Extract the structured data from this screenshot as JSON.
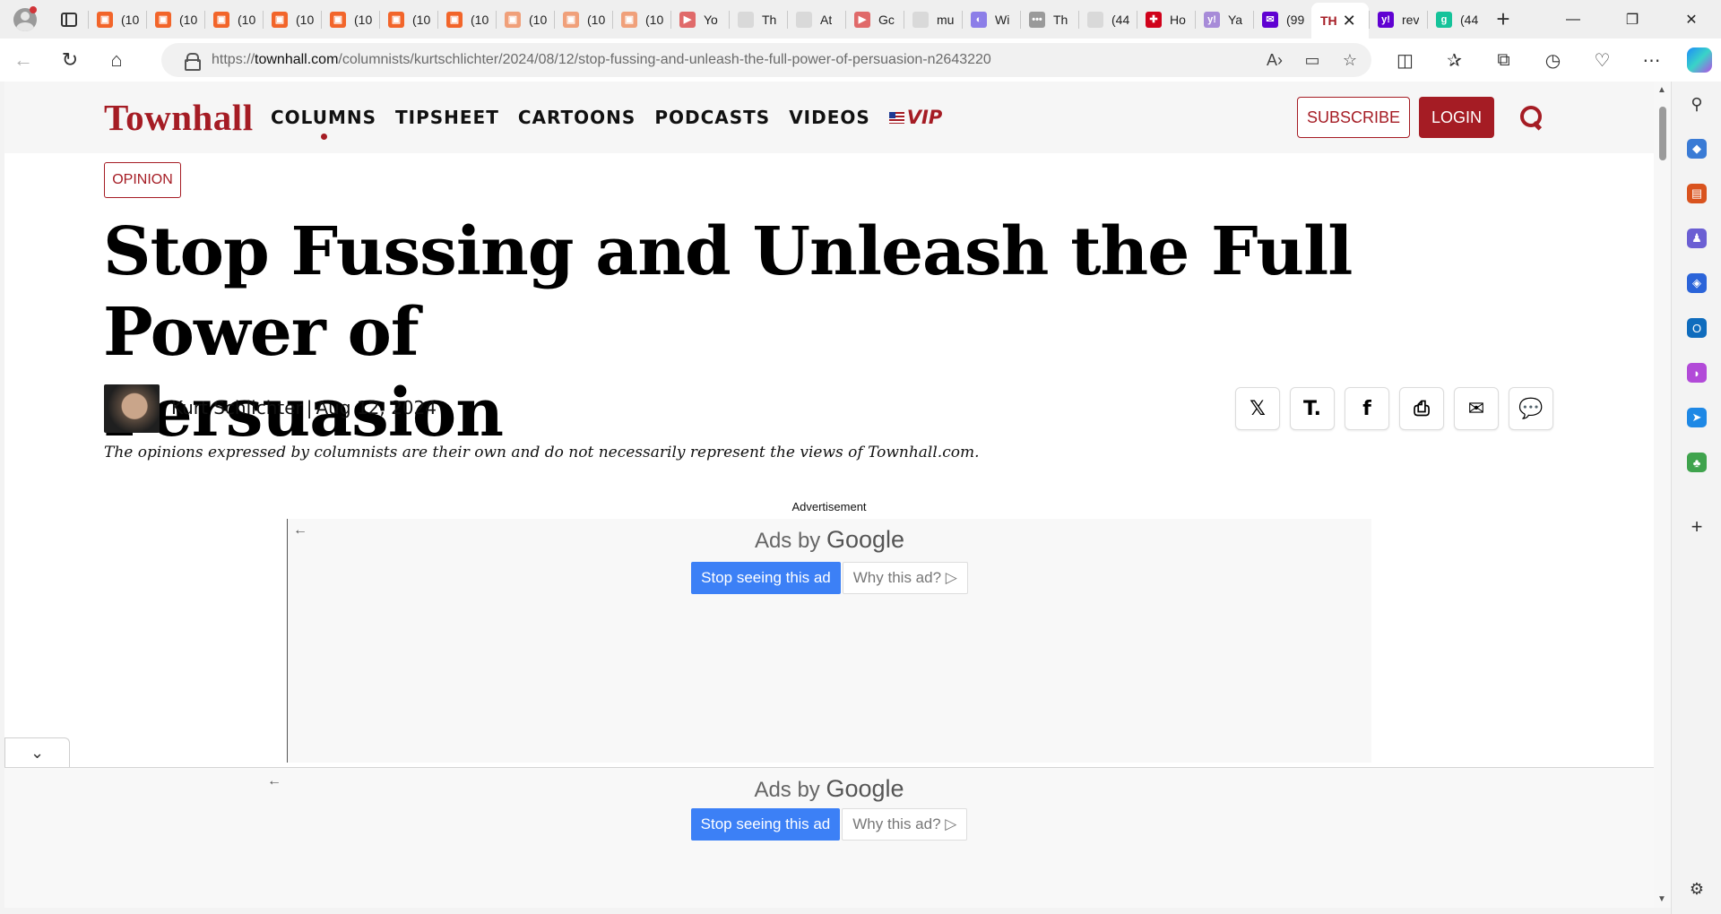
{
  "browser": {
    "tabs": [
      {
        "title": "(10",
        "favicon_color": "#f2652a",
        "favicon_glyph": "▣"
      },
      {
        "title": "(10",
        "favicon_color": "#f2652a",
        "favicon_glyph": "▣"
      },
      {
        "title": "(10",
        "favicon_color": "#f2652a",
        "favicon_glyph": "▣"
      },
      {
        "title": "(10",
        "favicon_color": "#f2652a",
        "favicon_glyph": "▣"
      },
      {
        "title": "(10",
        "favicon_color": "#f2652a",
        "favicon_glyph": "▣"
      },
      {
        "title": "(10",
        "favicon_color": "#f2652a",
        "favicon_glyph": "▣"
      },
      {
        "title": "(10",
        "favicon_color": "#f2652a",
        "favicon_glyph": "▣"
      },
      {
        "title": "(10",
        "favicon_color": "#f0a07a",
        "favicon_glyph": "▣"
      },
      {
        "title": "(10",
        "favicon_color": "#f0a07a",
        "favicon_glyph": "▣"
      },
      {
        "title": "(10",
        "favicon_color": "#f0a07a",
        "favicon_glyph": "▣"
      },
      {
        "title": "Yo",
        "favicon_color": "#e06a6a",
        "favicon_glyph": "▶"
      },
      {
        "title": "Th",
        "favicon_color": "#d9d9d9",
        "favicon_glyph": ""
      },
      {
        "title": "At",
        "favicon_color": "#d9d9d9",
        "favicon_glyph": ""
      },
      {
        "title": "Gc",
        "favicon_color": "#e06a6a",
        "favicon_glyph": "▶"
      },
      {
        "title": "mu",
        "favicon_color": "#d9d9d9",
        "favicon_glyph": ""
      },
      {
        "title": "Wi",
        "favicon_color": "#8c7ee8",
        "favicon_glyph": "◐"
      },
      {
        "title": "Th",
        "favicon_color": "#9a9a9a",
        "favicon_glyph": "•••"
      },
      {
        "title": "(44",
        "favicon_color": "#d9d9d9",
        "favicon_glyph": ""
      },
      {
        "title": "Ho",
        "favicon_color": "#d0021b",
        "favicon_glyph": "✚"
      },
      {
        "title": "Ya",
        "favicon_color": "#a78bd8",
        "favicon_glyph": "y!"
      },
      {
        "title": "(99",
        "favicon_color": "#6001d2",
        "favicon_glyph": "✉"
      },
      {
        "title": "TH",
        "favicon_color": "#a51c24",
        "favicon_glyph": "TH",
        "active": true
      },
      {
        "title": "rev",
        "favicon_color": "#6001d2",
        "favicon_glyph": "y!"
      },
      {
        "title": "(44",
        "favicon_color": "#15c39a",
        "favicon_glyph": "g"
      }
    ],
    "address_bar": {
      "url_prefix": "https://",
      "url_host": "townhall.com",
      "url_path": "/columnists/kurtschlichter/2024/08/12/stop-fussing-and-unleash-the-full-power-of-persuasion-n2643220"
    }
  },
  "site": {
    "logo": "Townhall",
    "nav": [
      "COLUMNS",
      "TIPSHEET",
      "CARTOONS",
      "PODCASTS",
      "VIDEOS"
    ],
    "nav_vip": "VIP",
    "subscribe_label": "SUBSCRIBE",
    "login_label": "LOGIN",
    "brand_color": "#a51c24"
  },
  "article": {
    "category": "OPINION",
    "headline_line1": "Stop Fussing and Unleash the Full Power of",
    "headline_line2": "Persuasion",
    "author": "Kurt Schlichter",
    "separator": "|",
    "date": "Aug 12, 2024",
    "disclaimer": "The opinions expressed by columnists are their own and do not necessarily represent the views of Townhall.com.",
    "share_buttons": [
      {
        "name": "share-x-button",
        "glyph": "𝕏"
      },
      {
        "name": "share-townhall-button",
        "glyph": "T."
      },
      {
        "name": "share-facebook-button",
        "glyph": "f"
      },
      {
        "name": "print-button",
        "glyph": "⎙"
      },
      {
        "name": "email-button",
        "glyph": "✉"
      },
      {
        "name": "comments-button",
        "glyph": "💬"
      }
    ]
  },
  "ads": {
    "label": "Advertisement",
    "ads_by": "Ads by",
    "google": "Google",
    "stop_label": "Stop seeing this ad",
    "why_label": "Why this ad? ▷"
  }
}
